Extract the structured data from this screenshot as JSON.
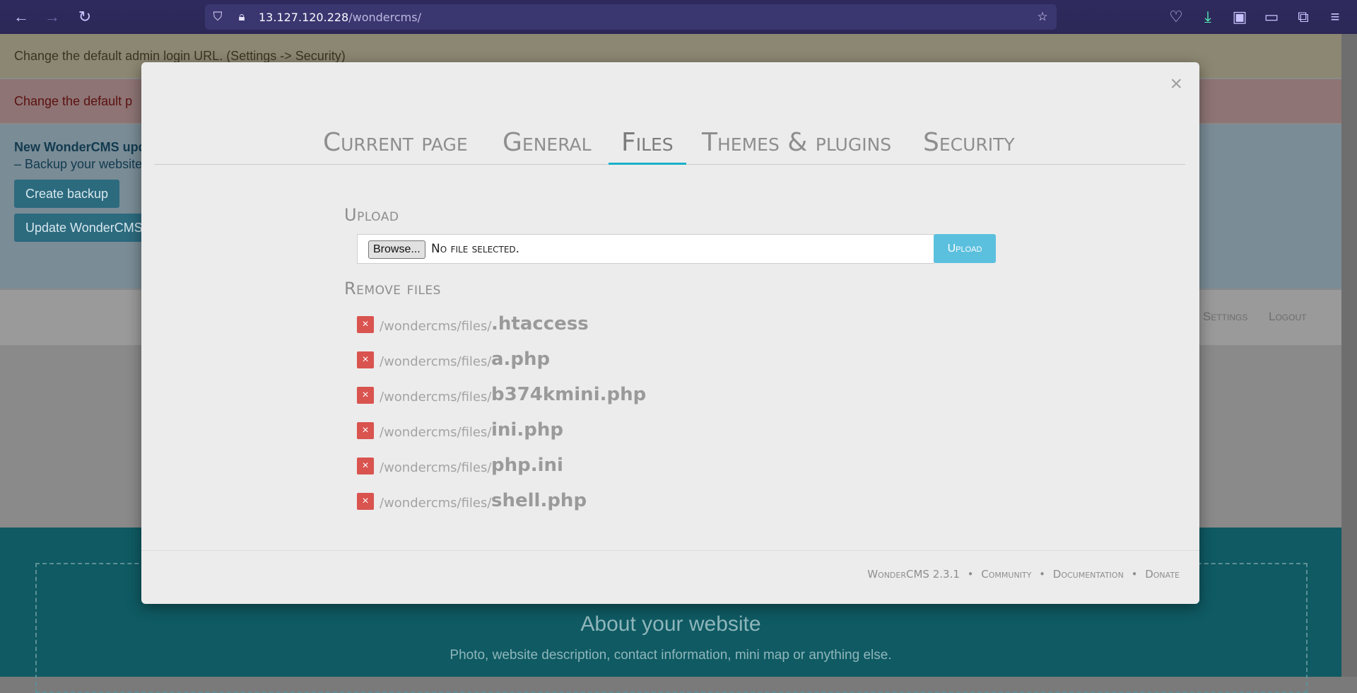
{
  "browser": {
    "url_host": "13.127.120.228",
    "url_path": "/wondercms/"
  },
  "page": {
    "alert_warning": "Change the default admin login URL. (Settings -> Security)",
    "alert_danger": "Change the default p",
    "alert_info_title": "New WonderCMS upd",
    "alert_info_text": "– Backup your website",
    "create_backup_label": "Create backup",
    "update_label": "Update WonderCMS",
    "menu_settings": "Settings",
    "menu_logout": "Logout",
    "about_title": "About your website",
    "about_subtitle": "Photo, website description, contact information, mini map or anything else."
  },
  "modal": {
    "close_symbol": "×",
    "tabs": [
      "Current page",
      "General",
      "Files",
      "Themes & plugins",
      "Security"
    ],
    "active_tab": "Files",
    "upload_title": "Upload",
    "browse_label": "Browse...",
    "no_file_text": "No file selected.",
    "upload_button": "Upload",
    "remove_title": "Remove files",
    "files": [
      {
        "path": "/wondercms/files/",
        "name": ".htaccess"
      },
      {
        "path": "/wondercms/files/",
        "name": "a.php"
      },
      {
        "path": "/wondercms/files/",
        "name": "b374kmini.php"
      },
      {
        "path": "/wondercms/files/",
        "name": "ini.php"
      },
      {
        "path": "/wondercms/files/",
        "name": "php.ini"
      },
      {
        "path": "/wondercms/files/",
        "name": "shell.php"
      }
    ],
    "delete_symbol": "×",
    "footer": {
      "version": "WonderCMS 2.3.1",
      "community": "Community",
      "documentation": "Documentation",
      "donate": "Donate",
      "separator": "•"
    }
  },
  "colors": {
    "accent": "#1ab0c9",
    "upload_button": "#5bc0de",
    "delete_button": "#d9534f",
    "browser_chrome": "#2b2856"
  }
}
